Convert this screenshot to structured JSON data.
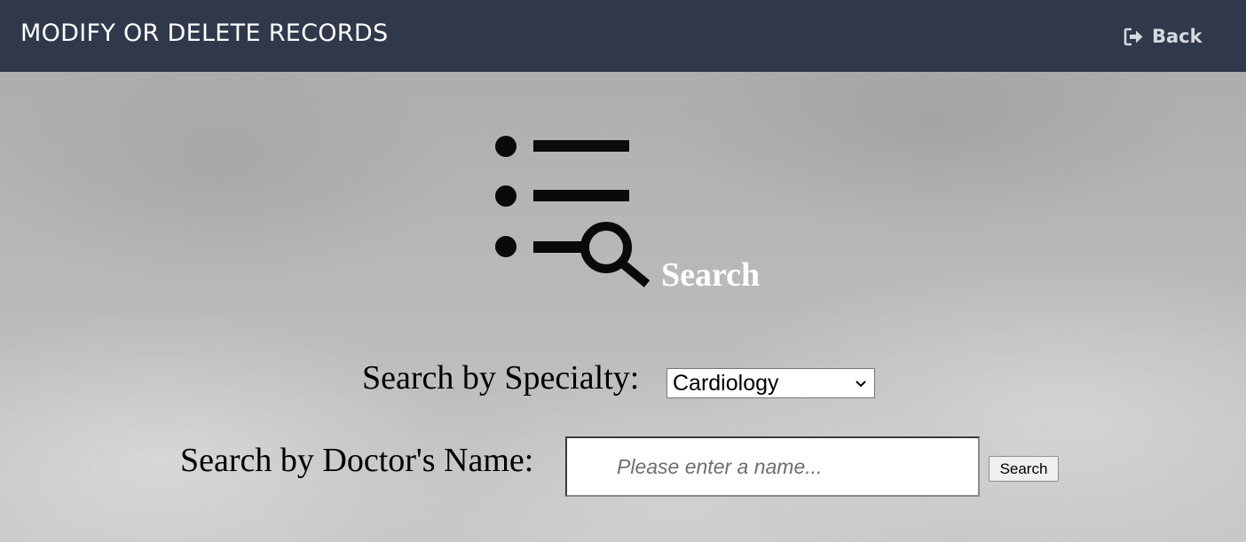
{
  "header": {
    "title": "MODIFY OR DELETE RECORDS",
    "back_label": "Back",
    "back_icon": "sign-out-icon",
    "background_color": "#2f394b"
  },
  "hero": {
    "icon": "list-search-icon",
    "label": "Search"
  },
  "specialty": {
    "label": "Search by Specialty:",
    "selected": "Cardiology"
  },
  "doctor_name": {
    "label": "Search by Doctor's Name:",
    "placeholder": "Please enter a name...",
    "value": "",
    "button_label": "Search"
  }
}
